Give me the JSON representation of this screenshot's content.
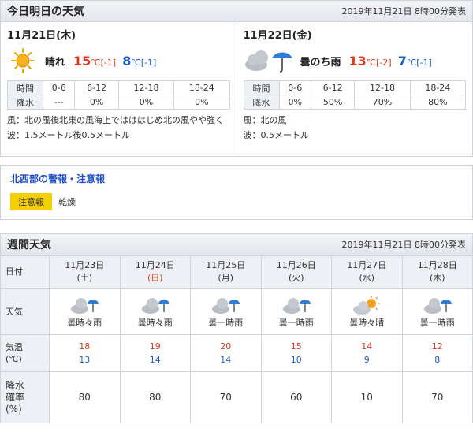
{
  "today_tomorrow": {
    "title": "今日明日の天気",
    "issued": "2019年11月21日 8時00分発表",
    "days": [
      {
        "date": "11月21日(木)",
        "icon": "sun-icon",
        "weather": "晴れ",
        "high": "15",
        "high_diff": "[-1]",
        "low": "8",
        "low_diff": "[-1]",
        "unit": "℃",
        "time_label": "時間",
        "rain_label": "降水",
        "periods": [
          "0-6",
          "6-12",
          "12-18",
          "18-24"
        ],
        "rain": [
          "---",
          "0%",
          "0%",
          "0%"
        ],
        "wind": "風：北の風後北東の風海上ではははじめ北の風やや強く",
        "wave": "波：1.5メートル後0.5メートル"
      },
      {
        "date": "11月22日(金)",
        "icon": "cloud-rain-icon",
        "weather": "曇のち雨",
        "high": "13",
        "high_diff": "[-2]",
        "low": "7",
        "low_diff": "[-1]",
        "unit": "℃",
        "time_label": "時間",
        "rain_label": "降水",
        "periods": [
          "0-6",
          "6-12",
          "12-18",
          "18-24"
        ],
        "rain": [
          "0%",
          "50%",
          "70%",
          "80%"
        ],
        "wind": "風：北の風",
        "wave": "波：0.5メートル"
      }
    ]
  },
  "warnings": {
    "title": "北西部の警報・注意報",
    "badge": "注意報",
    "value": "乾燥"
  },
  "weekly": {
    "title": "週間天気",
    "issued": "2019年11月21日 8時00分発表",
    "labels": {
      "date": "日付",
      "weather": "天気",
      "temp_1": "気温",
      "temp_2": "(℃)",
      "pop_1": "降水",
      "pop_2": "確率",
      "pop_3": "(%)"
    },
    "days": [
      {
        "date": "11月23日",
        "dow": "(土)",
        "weather": "曇時々雨",
        "icon": "cloud-rain-icon",
        "high": "18",
        "low": "13",
        "pop": "80"
      },
      {
        "date": "11月24日",
        "dow": "(日)",
        "weather": "曇時々雨",
        "icon": "cloud-rain-icon",
        "high": "19",
        "low": "14",
        "pop": "80"
      },
      {
        "date": "11月25日",
        "dow": "(月)",
        "weather": "曇一時雨",
        "icon": "cloud-rain-icon",
        "high": "20",
        "low": "14",
        "pop": "70"
      },
      {
        "date": "11月26日",
        "dow": "(火)",
        "weather": "曇一時雨",
        "icon": "cloud-rain-icon",
        "high": "15",
        "low": "10",
        "pop": "60"
      },
      {
        "date": "11月27日",
        "dow": "(水)",
        "weather": "曇時々晴",
        "icon": "cloud-sun-icon",
        "high": "14",
        "low": "9",
        "pop": "10"
      },
      {
        "date": "11月28日",
        "dow": "(木)",
        "weather": "曇一時雨",
        "icon": "cloud-rain-icon",
        "high": "12",
        "low": "8",
        "pop": "70"
      }
    ]
  },
  "colors": {
    "high": "#e0391e",
    "low": "#1f5fc8",
    "badge": "#f5d000",
    "link": "#1f4ec8"
  }
}
